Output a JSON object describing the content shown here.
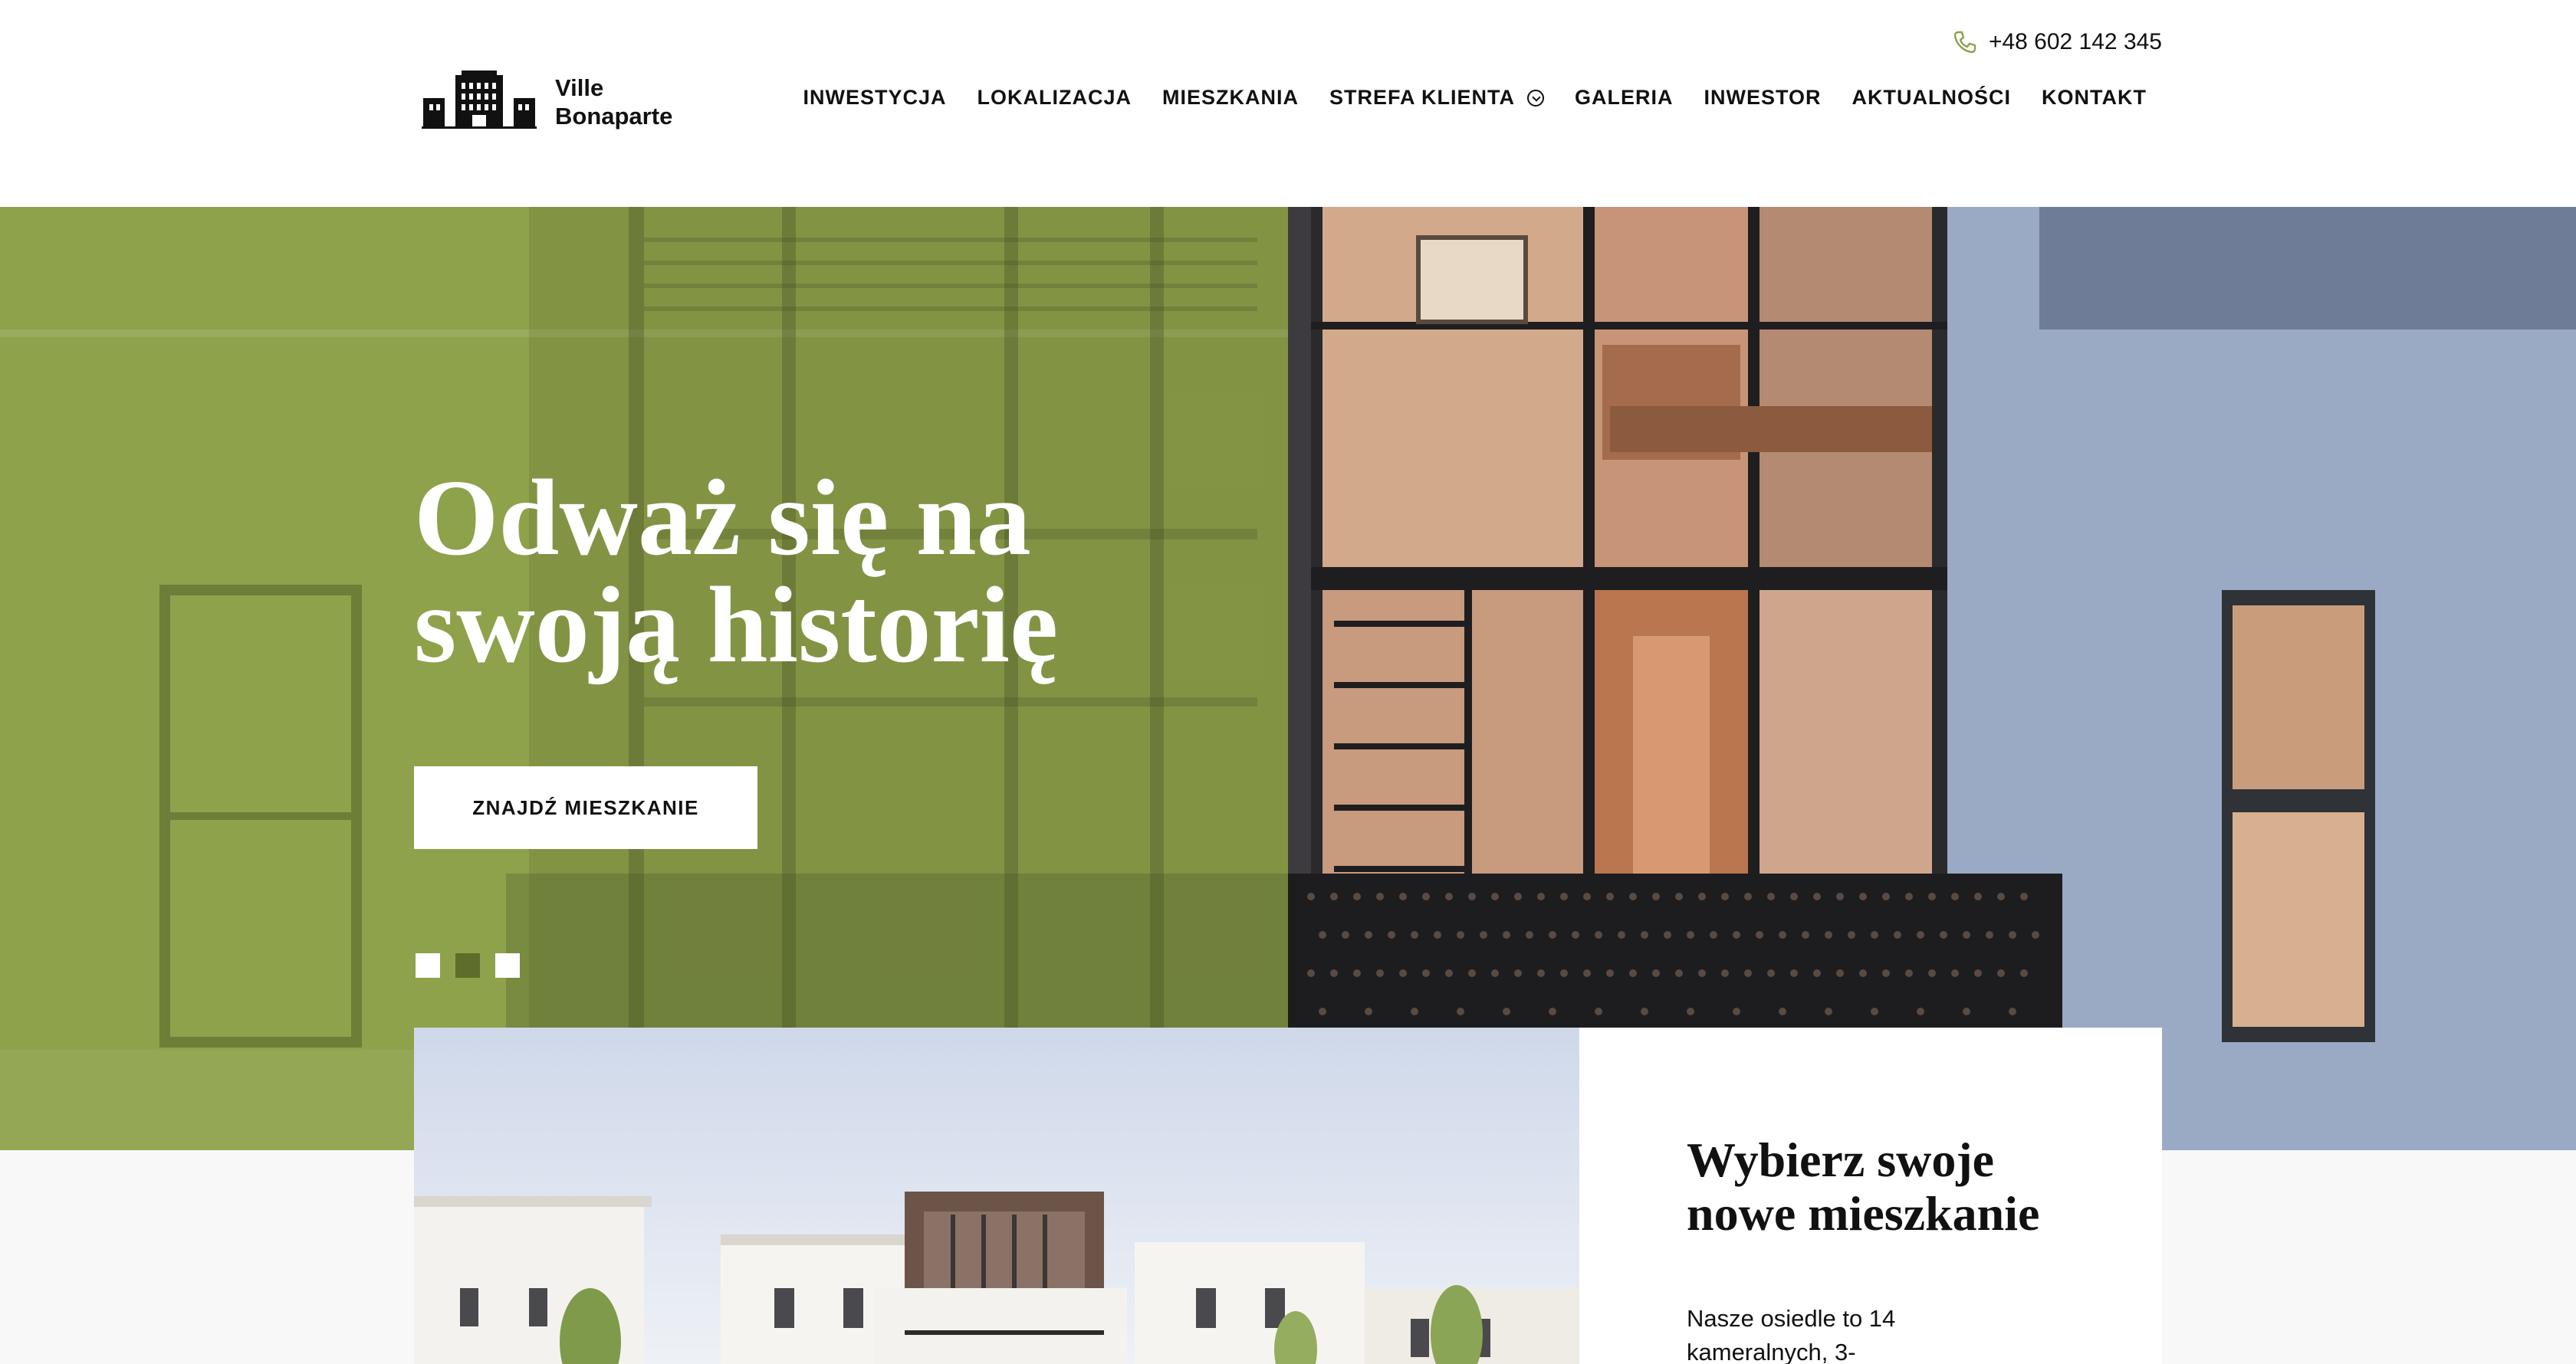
{
  "header": {
    "phone": "+48 602 142 345",
    "logo_line1": "Ville",
    "logo_line2": "Bonaparte",
    "nav": [
      {
        "label": "INWESTYCJA"
      },
      {
        "label": "LOKALIZACJA"
      },
      {
        "label": "MIESZKANIA"
      },
      {
        "label": "STREFA KLIENTA",
        "has_dropdown": true
      },
      {
        "label": "GALERIA"
      },
      {
        "label": "INWESTOR"
      },
      {
        "label": "AKTUALNOŚCI"
      },
      {
        "label": "KONTAKT"
      }
    ]
  },
  "hero": {
    "title_line1": "Odważ się na",
    "title_line2": "swoją historię",
    "cta_label": "ZNAJDŹ MIESZKANIE",
    "slider_count": 3,
    "active_slide": 2
  },
  "section": {
    "title_line1": "Wybierz swoje",
    "title_line2": "nowe mieszkanie",
    "body_line1": "Nasze osiedle to 14",
    "body_line2": "kameralnych, 3-"
  },
  "icons": {
    "phone": "phone-icon",
    "dropdown": "chevron-down-circle-icon",
    "logo": "building-logo-icon"
  },
  "colors": {
    "accent_green": "#8ea24b",
    "dot_active": "#5f6d2a",
    "wall_blue": "#9aaac4"
  }
}
